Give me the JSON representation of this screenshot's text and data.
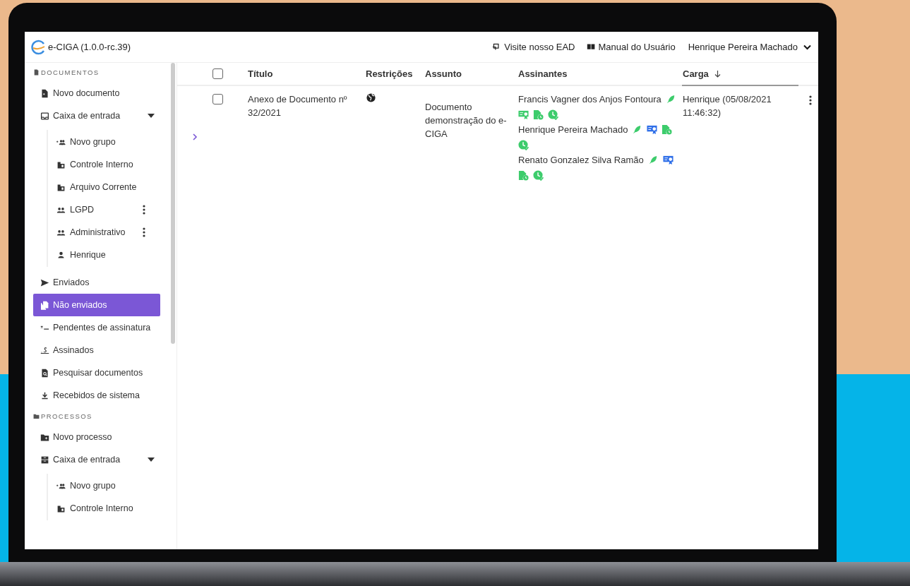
{
  "header": {
    "app_title": "e-CIGA (1.0.0-rc.39)",
    "links": [
      {
        "kind": "ead",
        "label": "Visite nosso EAD"
      },
      {
        "kind": "manual",
        "label": "Manual do Usuário"
      }
    ],
    "user": "Henrique Pereira Machado"
  },
  "sidebar": {
    "sections": [
      {
        "title": "DOCUMENTOS",
        "kind": "documents",
        "items": [
          {
            "kind": "new-doc",
            "label": "Novo documento",
            "selected": false
          },
          {
            "kind": "inbox",
            "label": "Caixa de entrada",
            "selected": false,
            "expanded": true,
            "children": [
              {
                "kind": "new-group",
                "label": "Novo grupo",
                "selected": false,
                "has_menu": false
              },
              {
                "kind": "org",
                "label": "Controle Interno",
                "selected": false,
                "has_menu": false
              },
              {
                "kind": "org",
                "label": "Arquivo Corrente",
                "selected": false,
                "has_menu": false
              },
              {
                "kind": "group",
                "label": "LGPD",
                "selected": false,
                "has_menu": true
              },
              {
                "kind": "group",
                "label": "Administrativo",
                "selected": false,
                "has_menu": true
              },
              {
                "kind": "person",
                "label": "Henrique",
                "selected": false,
                "has_menu": false
              }
            ]
          },
          {
            "kind": "send",
            "label": "Enviados",
            "selected": false
          },
          {
            "kind": "file",
            "label": "Não enviados",
            "selected": true
          },
          {
            "kind": "pending",
            "label": "Pendentes de assinatura",
            "selected": false
          },
          {
            "kind": "signed",
            "label": "Assinados",
            "selected": false
          },
          {
            "kind": "search-doc",
            "label": "Pesquisar documentos",
            "selected": false
          },
          {
            "kind": "download",
            "label": "Recebidos de sistema",
            "selected": false
          }
        ]
      },
      {
        "title": "PROCESSOS",
        "kind": "folder",
        "items": [
          {
            "kind": "new-folder",
            "label": "Novo processo",
            "selected": false
          },
          {
            "kind": "archive",
            "label": "Caixa de entrada",
            "selected": false,
            "expanded": true,
            "children": [
              {
                "kind": "new-group",
                "label": "Novo grupo",
                "selected": false,
                "has_menu": false
              },
              {
                "kind": "org",
                "label": "Controle Interno",
                "selected": false,
                "has_menu": false
              }
            ]
          }
        ]
      }
    ]
  },
  "table": {
    "columns": [
      {
        "label": "Título",
        "sorted": false
      },
      {
        "label": "Restrições",
        "sorted": false
      },
      {
        "label": "Assunto",
        "sorted": false
      },
      {
        "label": "Assinantes",
        "sorted": false
      },
      {
        "label": "Carga",
        "sorted": true
      }
    ],
    "rows": [
      {
        "checked": false,
        "expanded": false,
        "title": "Anexo de Documento nº 32/2021",
        "restriction": {
          "kind": "public"
        },
        "subject": "Documento demonstração do e-CIGA",
        "carga": "Henrique (05/08/2021 11:46:32)",
        "signers": [
          {
            "name": "Francis Vagner dos Anjos Fontoura",
            "icons": [
              {
                "kind": "pen",
                "color": "#3dcc6c"
              },
              {
                "kind": "cert",
                "color": "#3dcc6c"
              },
              {
                "kind": "doc-clock",
                "color": "#3dcc6c"
              },
              {
                "kind": "clock-check",
                "color": "#3dcc6c"
              }
            ]
          },
          {
            "name": "Henrique Pereira Machado",
            "icons": [
              {
                "kind": "pen",
                "color": "#3dcc6c"
              },
              {
                "kind": "cert",
                "color": "#2f6fe8"
              },
              {
                "kind": "doc-clock",
                "color": "#3dcc6c"
              },
              {
                "kind": "clock-check",
                "color": "#3dcc6c"
              }
            ]
          },
          {
            "name": "Renato Gonzalez Silva Ramão",
            "icons": [
              {
                "kind": "pen",
                "color": "#3dcc6c"
              },
              {
                "kind": "cert",
                "color": "#2f6fe8"
              },
              {
                "kind": "doc-clock",
                "color": "#3dcc6c"
              },
              {
                "kind": "clock-check",
                "color": "#3dcc6c"
              }
            ]
          }
        ]
      }
    ],
    "header_checked": false
  }
}
